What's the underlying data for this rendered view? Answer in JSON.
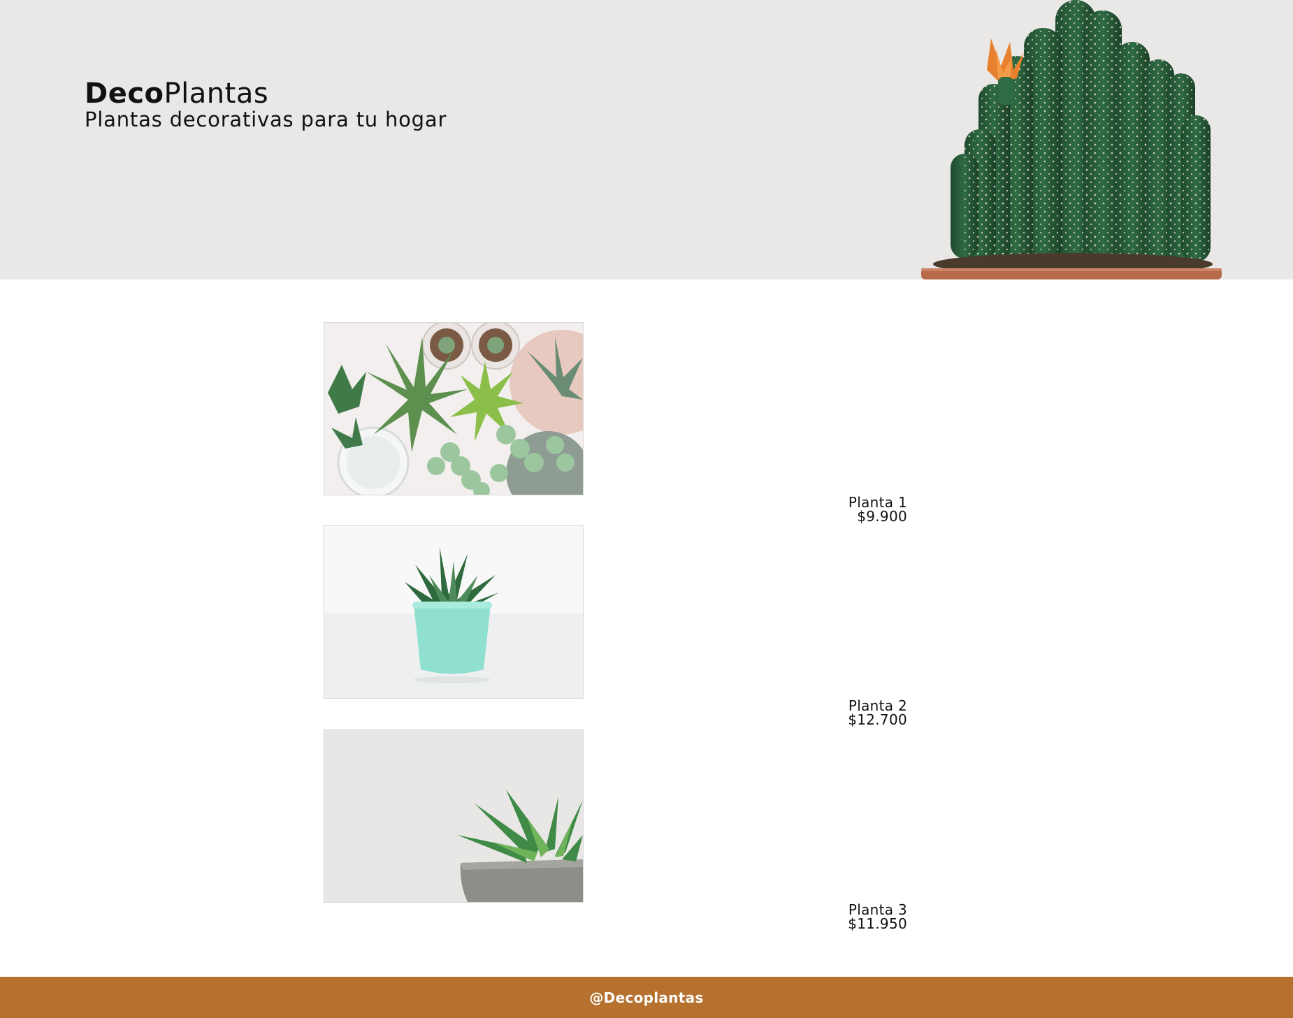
{
  "header": {
    "brand_bold": "Deco",
    "brand_regular": "Plantas",
    "tagline": "Plantas decorativas para tu hogar",
    "hero_image_icon": "potted-cactus-photo"
  },
  "products": [
    {
      "name": "Planta 1",
      "price": "$9.900",
      "photo_icon": "succulent-collection-photo"
    },
    {
      "name": "Planta 2",
      "price": "$12.700",
      "photo_icon": "potted-haworthia-photo"
    },
    {
      "name": "Planta 3",
      "price": "$11.950",
      "photo_icon": "echeveria-pot-photo"
    }
  ],
  "footer": {
    "handle": "@Decoplantas"
  },
  "colors": {
    "hero_background": "#e9e8e6",
    "footer_background": "#b5712d",
    "footer_text": "#ffffff",
    "text": "#111111"
  }
}
